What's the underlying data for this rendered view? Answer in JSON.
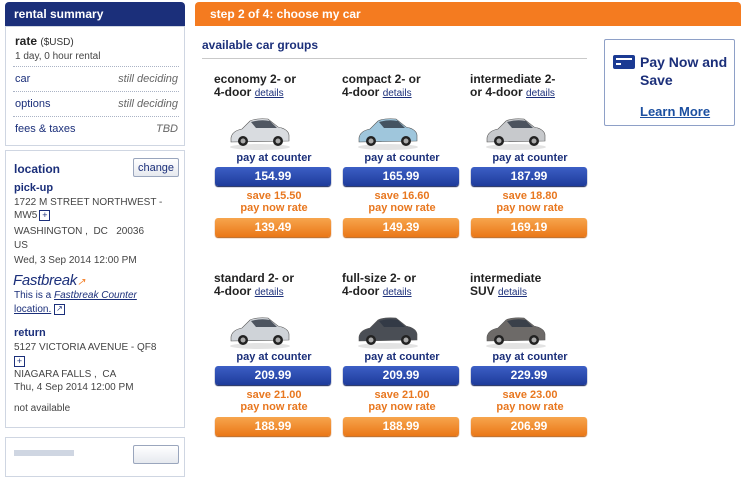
{
  "sidebar": {
    "title": "rental summary",
    "rate_label": "rate",
    "rate_currency": "($USD)",
    "rate_desc": "1 day, 0 hour rental",
    "rows": [
      {
        "label": "car",
        "value": "still deciding"
      },
      {
        "label": "options",
        "value": "still deciding"
      },
      {
        "label": "fees & taxes",
        "value": "TBD"
      }
    ],
    "location_label": "location",
    "change_label": "change",
    "pickup_label": "pick-up",
    "pickup_address1": "1722 M STREET NORTHWEST -",
    "pickup_address2": "MW5",
    "pickup_city": "WASHINGTON ,  DC   20036",
    "pickup_country": "US",
    "pickup_datetime": "Wed, 3 Sep 2014 12:00 PM",
    "fastbreak_logo": "Fastbreak",
    "fastbreak_text1": "This is a",
    "fastbreak_link": "Fastbreak Counter",
    "fastbreak_text2": "location.",
    "return_label": "return",
    "return_address": "5127 VICTORIA AVENUE - QF8",
    "return_city": "NIAGARA FALLS ,  CA",
    "return_datetime": "Thu, 4 Sep 2014 12:00 PM",
    "availability": "not available"
  },
  "main": {
    "step_title": "step 2 of 4: choose my car",
    "section_title": "available car groups",
    "details_label": "details",
    "pay_counter_label": "pay at counter",
    "pay_now_rate_label": "pay now rate",
    "cars": [
      {
        "name1": "economy 2- or",
        "name2": "4-door",
        "counter_price": "154.99",
        "save": "save 15.50",
        "now_price": "139.49",
        "color": "#d9dce0"
      },
      {
        "name1": "compact 2- or",
        "name2": "4-door",
        "counter_price": "165.99",
        "save": "save 16.60",
        "now_price": "149.39",
        "color": "#9fc6dc"
      },
      {
        "name1": "intermediate 2-",
        "name2": "or 4-door",
        "counter_price": "187.99",
        "save": "save 18.80",
        "now_price": "169.19",
        "color": "#c7c9cc"
      },
      {
        "name1": "standard 2- or",
        "name2": "4-door",
        "counter_price": "209.99",
        "save": "save 21.00",
        "now_price": "188.99",
        "color": "#cfd3d8"
      },
      {
        "name1": "full-size 2- or",
        "name2": "4-door",
        "counter_price": "209.99",
        "save": "save 21.00",
        "now_price": "188.99",
        "color": "#4a4e55"
      },
      {
        "name1": "intermediate",
        "name2": "SUV",
        "counter_price": "229.99",
        "save": "save 23.00",
        "now_price": "206.99",
        "color": "#6d6a68"
      }
    ]
  },
  "promo": {
    "title": "Pay Now and Save",
    "link": "Learn More",
    "icon": "credit-card-icon"
  },
  "colors": {
    "brand_blue": "#1b2f7a",
    "brand_orange": "#f47b20"
  }
}
